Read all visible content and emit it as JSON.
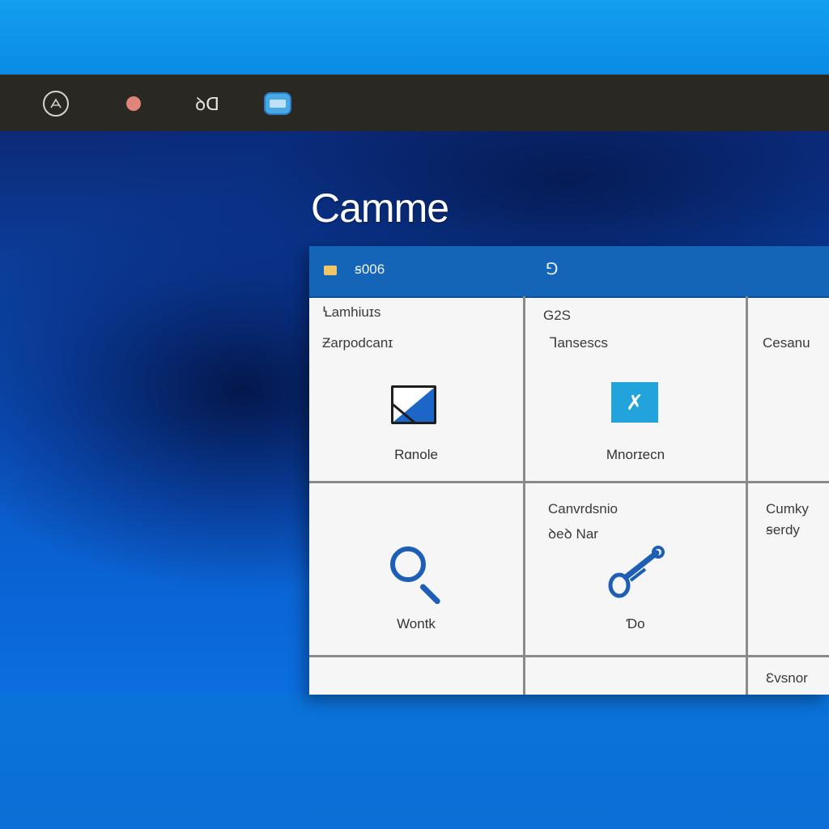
{
  "toolbar": {
    "icons": [
      "app-logo-icon",
      "record-dot-icon",
      "text-glyph-icon",
      "display-icon"
    ],
    "text_glyph": "ꝺᗡ"
  },
  "hero": {
    "title": "Camme"
  },
  "panel": {
    "header_title": "ꞩ006",
    "header_mark": "⅁"
  },
  "cells": {
    "c1": {
      "top_line1": "Ꝇamhiuɪs",
      "top_line2": "Ƶarpodcanɪ",
      "caption": "Rɑnole"
    },
    "c2": {
      "top_line1": "G2S",
      "top_line2": "Ꞁansescs",
      "caption": "Mnorɪecn"
    },
    "c3": {
      "top_line1": "Cesanu"
    },
    "c4": {
      "caption": "Wontk"
    },
    "c5": {
      "top_line1": "Canvrdsnio",
      "top_line2": "ꝺeꝺ Nar",
      "caption": "Ɗo"
    },
    "c6": {
      "top_line1": "Cumky",
      "top_line2": "ꞩerdy"
    },
    "c9": {
      "top_line1": "Ɛvsnor"
    }
  },
  "colors": {
    "toolbar_bg": "#2a2823",
    "panel_header": "#1464b8",
    "accent_blue": "#1b66c6",
    "tile_cyan": "#22a3dc"
  }
}
